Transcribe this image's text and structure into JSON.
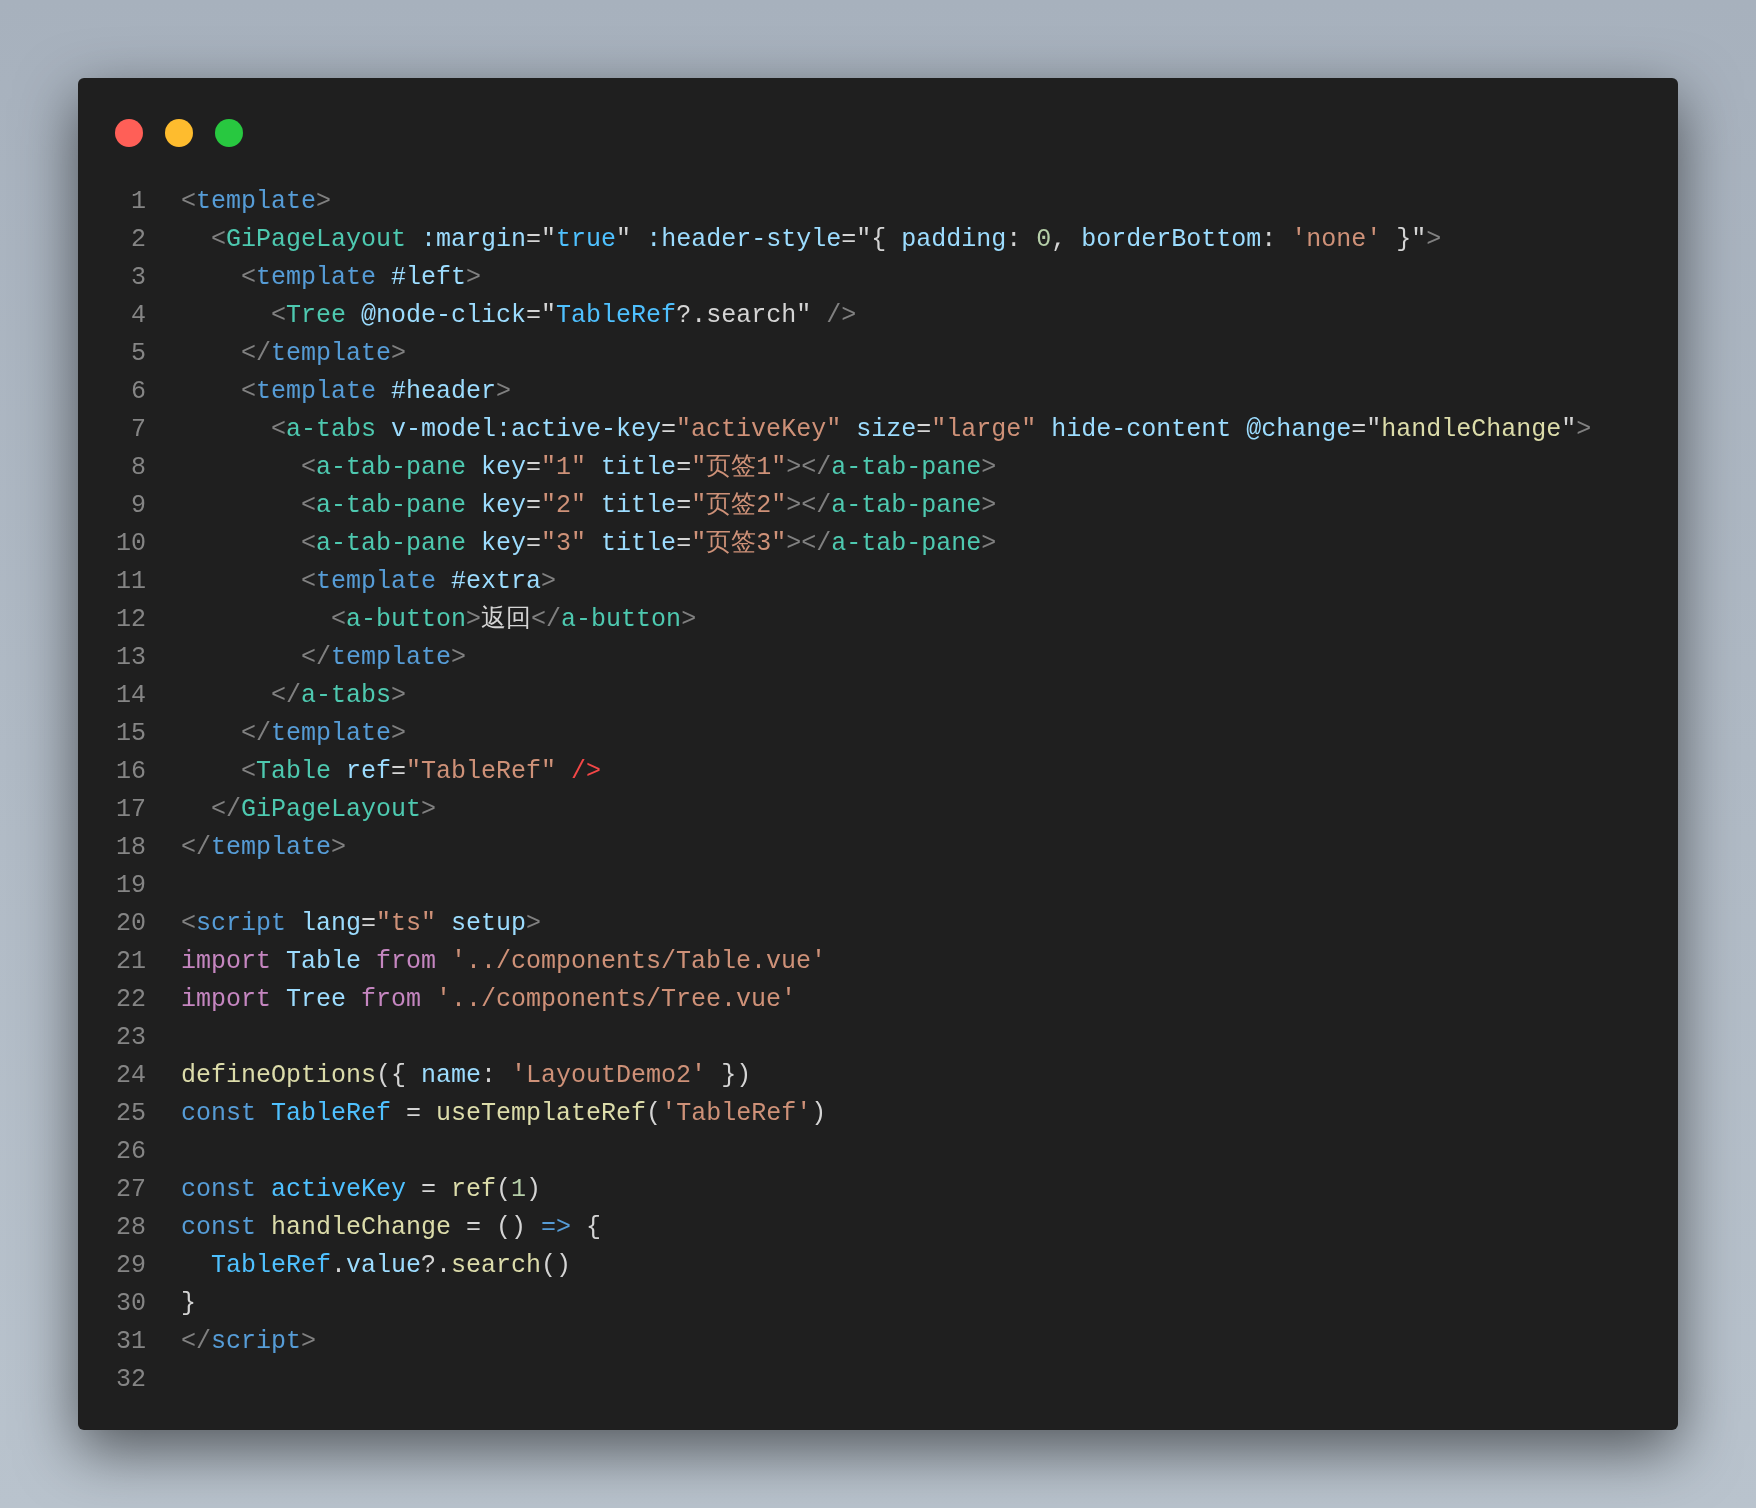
{
  "window_controls": [
    {
      "color": "#ff5f57"
    },
    {
      "color": "#febc2e"
    },
    {
      "color": "#28c840"
    }
  ],
  "code_lines": [
    {
      "number": "1",
      "tokens": [
        {
          "text": "<",
          "kind": "punct"
        },
        {
          "text": "template",
          "kind": "tag"
        },
        {
          "text": ">",
          "kind": "punct"
        }
      ]
    },
    {
      "number": "2",
      "tokens": [
        {
          "text": "  <",
          "kind": "punct"
        },
        {
          "text": "GiPageLayout",
          "kind": "component"
        },
        {
          "text": " :margin",
          "kind": "attr"
        },
        {
          "text": "=\"",
          "kind": "plain"
        },
        {
          "text": "true",
          "kind": "const"
        },
        {
          "text": "\"",
          "kind": "plain"
        },
        {
          "text": " :header-style",
          "kind": "attr"
        },
        {
          "text": "=\"{ ",
          "kind": "plain"
        },
        {
          "text": "padding",
          "kind": "attr"
        },
        {
          "text": ": ",
          "kind": "plain"
        },
        {
          "text": "0",
          "kind": "num"
        },
        {
          "text": ", ",
          "kind": "plain"
        },
        {
          "text": "borderBottom",
          "kind": "attr"
        },
        {
          "text": ": ",
          "kind": "plain"
        },
        {
          "text": "'none'",
          "kind": "string"
        },
        {
          "text": " }\"",
          "kind": "plain"
        },
        {
          "text": ">",
          "kind": "punct"
        }
      ]
    },
    {
      "number": "3",
      "tokens": [
        {
          "text": "    <",
          "kind": "punct"
        },
        {
          "text": "template",
          "kind": "tag"
        },
        {
          "text": " #left",
          "kind": "attr"
        },
        {
          "text": ">",
          "kind": "punct"
        }
      ]
    },
    {
      "number": "4",
      "tokens": [
        {
          "text": "      <",
          "kind": "punct"
        },
        {
          "text": "Tree",
          "kind": "component"
        },
        {
          "text": " @node-click",
          "kind": "attr"
        },
        {
          "text": "=\"",
          "kind": "plain"
        },
        {
          "text": "TableRef",
          "kind": "const"
        },
        {
          "text": "?.search\"",
          "kind": "plain"
        },
        {
          "text": " />",
          "kind": "punct"
        }
      ]
    },
    {
      "number": "5",
      "tokens": [
        {
          "text": "    </",
          "kind": "punct"
        },
        {
          "text": "template",
          "kind": "tag"
        },
        {
          "text": ">",
          "kind": "punct"
        }
      ]
    },
    {
      "number": "6",
      "tokens": [
        {
          "text": "    <",
          "kind": "punct"
        },
        {
          "text": "template",
          "kind": "tag"
        },
        {
          "text": " #header",
          "kind": "attr"
        },
        {
          "text": ">",
          "kind": "punct"
        }
      ]
    },
    {
      "number": "7",
      "tokens": [
        {
          "text": "      <",
          "kind": "punct"
        },
        {
          "text": "a-tabs",
          "kind": "component"
        },
        {
          "text": " v-model:active-key",
          "kind": "attr"
        },
        {
          "text": "=",
          "kind": "plain"
        },
        {
          "text": "\"activeKey\"",
          "kind": "string"
        },
        {
          "text": " size",
          "kind": "attr"
        },
        {
          "text": "=",
          "kind": "plain"
        },
        {
          "text": "\"large\"",
          "kind": "string"
        },
        {
          "text": " hide-content @change",
          "kind": "attr"
        },
        {
          "text": "=\"",
          "kind": "plain"
        },
        {
          "text": "handleChange",
          "kind": "fn"
        },
        {
          "text": "\"",
          "kind": "plain"
        },
        {
          "text": ">",
          "kind": "punct"
        }
      ]
    },
    {
      "number": "8",
      "tokens": [
        {
          "text": "        <",
          "kind": "punct"
        },
        {
          "text": "a-tab-pane",
          "kind": "component"
        },
        {
          "text": " key",
          "kind": "attr"
        },
        {
          "text": "=",
          "kind": "plain"
        },
        {
          "text": "\"1\"",
          "kind": "string"
        },
        {
          "text": " title",
          "kind": "attr"
        },
        {
          "text": "=",
          "kind": "plain"
        },
        {
          "text": "\"页签1\"",
          "kind": "string"
        },
        {
          "text": "></",
          "kind": "punct"
        },
        {
          "text": "a-tab-pane",
          "kind": "component"
        },
        {
          "text": ">",
          "kind": "punct"
        }
      ]
    },
    {
      "number": "9",
      "tokens": [
        {
          "text": "        <",
          "kind": "punct"
        },
        {
          "text": "a-tab-pane",
          "kind": "component"
        },
        {
          "text": " key",
          "kind": "attr"
        },
        {
          "text": "=",
          "kind": "plain"
        },
        {
          "text": "\"2\"",
          "kind": "string"
        },
        {
          "text": " title",
          "kind": "attr"
        },
        {
          "text": "=",
          "kind": "plain"
        },
        {
          "text": "\"页签2\"",
          "kind": "string"
        },
        {
          "text": "></",
          "kind": "punct"
        },
        {
          "text": "a-tab-pane",
          "kind": "component"
        },
        {
          "text": ">",
          "kind": "punct"
        }
      ]
    },
    {
      "number": "10",
      "tokens": [
        {
          "text": "        <",
          "kind": "punct"
        },
        {
          "text": "a-tab-pane",
          "kind": "component"
        },
        {
          "text": " key",
          "kind": "attr"
        },
        {
          "text": "=",
          "kind": "plain"
        },
        {
          "text": "\"3\"",
          "kind": "string"
        },
        {
          "text": " title",
          "kind": "attr"
        },
        {
          "text": "=",
          "kind": "plain"
        },
        {
          "text": "\"页签3\"",
          "kind": "string"
        },
        {
          "text": "></",
          "kind": "punct"
        },
        {
          "text": "a-tab-pane",
          "kind": "component"
        },
        {
          "text": ">",
          "kind": "punct"
        }
      ]
    },
    {
      "number": "11",
      "tokens": [
        {
          "text": "        <",
          "kind": "punct"
        },
        {
          "text": "template",
          "kind": "tag"
        },
        {
          "text": " #extra",
          "kind": "attr"
        },
        {
          "text": ">",
          "kind": "punct"
        }
      ]
    },
    {
      "number": "12",
      "tokens": [
        {
          "text": "          <",
          "kind": "punct"
        },
        {
          "text": "a-button",
          "kind": "component"
        },
        {
          "text": ">",
          "kind": "punct"
        },
        {
          "text": "返回",
          "kind": "plain"
        },
        {
          "text": "</",
          "kind": "punct"
        },
        {
          "text": "a-button",
          "kind": "component"
        },
        {
          "text": ">",
          "kind": "punct"
        }
      ]
    },
    {
      "number": "13",
      "tokens": [
        {
          "text": "        </",
          "kind": "punct"
        },
        {
          "text": "template",
          "kind": "tag"
        },
        {
          "text": ">",
          "kind": "punct"
        }
      ]
    },
    {
      "number": "14",
      "tokens": [
        {
          "text": "      </",
          "kind": "punct"
        },
        {
          "text": "a-tabs",
          "kind": "component"
        },
        {
          "text": ">",
          "kind": "punct"
        }
      ]
    },
    {
      "number": "15",
      "tokens": [
        {
          "text": "    </",
          "kind": "punct"
        },
        {
          "text": "template",
          "kind": "tag"
        },
        {
          "text": ">",
          "kind": "punct"
        }
      ]
    },
    {
      "number": "16",
      "tokens": [
        {
          "text": "    <",
          "kind": "punct"
        },
        {
          "text": "Table",
          "kind": "component"
        },
        {
          "text": " ref",
          "kind": "attr"
        },
        {
          "text": "=",
          "kind": "plain"
        },
        {
          "text": "\"TableRef\"",
          "kind": "string"
        },
        {
          "text": " />",
          "kind": "error"
        }
      ]
    },
    {
      "number": "17",
      "tokens": [
        {
          "text": "  </",
          "kind": "punct"
        },
        {
          "text": "GiPageLayout",
          "kind": "component"
        },
        {
          "text": ">",
          "kind": "punct"
        }
      ]
    },
    {
      "number": "18",
      "tokens": [
        {
          "text": "</",
          "kind": "punct"
        },
        {
          "text": "template",
          "kind": "tag"
        },
        {
          "text": ">",
          "kind": "punct"
        }
      ]
    },
    {
      "number": "19"
    },
    {
      "number": "20",
      "tokens": [
        {
          "text": "<",
          "kind": "punct"
        },
        {
          "text": "script",
          "kind": "tag"
        },
        {
          "text": " lang",
          "kind": "attr"
        },
        {
          "text": "=",
          "kind": "plain"
        },
        {
          "text": "\"ts\"",
          "kind": "string"
        },
        {
          "text": " setup",
          "kind": "attr"
        },
        {
          "text": ">",
          "kind": "punct"
        }
      ]
    },
    {
      "number": "21",
      "tokens": [
        {
          "text": "import",
          "kind": "keyword"
        },
        {
          "text": " Table ",
          "kind": "var"
        },
        {
          "text": "from",
          "kind": "keyword"
        },
        {
          "text": " '../components/Table.vue'",
          "kind": "string"
        }
      ]
    },
    {
      "number": "22",
      "tokens": [
        {
          "text": "import",
          "kind": "keyword"
        },
        {
          "text": " Tree ",
          "kind": "var"
        },
        {
          "text": "from",
          "kind": "keyword"
        },
        {
          "text": " '../components/Tree.vue'",
          "kind": "string"
        }
      ]
    },
    {
      "number": "23"
    },
    {
      "number": "24",
      "tokens": [
        {
          "text": "defineOptions",
          "kind": "fn"
        },
        {
          "text": "({ ",
          "kind": "plain"
        },
        {
          "text": "name",
          "kind": "var"
        },
        {
          "text": ": ",
          "kind": "plain"
        },
        {
          "text": "'LayoutDemo2'",
          "kind": "string"
        },
        {
          "text": " })",
          "kind": "plain"
        }
      ]
    },
    {
      "number": "25",
      "tokens": [
        {
          "text": "const",
          "kind": "storage"
        },
        {
          "text": " TableRef",
          "kind": "const"
        },
        {
          "text": " = ",
          "kind": "plain"
        },
        {
          "text": "useTemplateRef",
          "kind": "fn"
        },
        {
          "text": "(",
          "kind": "plain"
        },
        {
          "text": "'TableRef'",
          "kind": "string"
        },
        {
          "text": ")",
          "kind": "plain"
        }
      ]
    },
    {
      "number": "26"
    },
    {
      "number": "27",
      "tokens": [
        {
          "text": "const",
          "kind": "storage"
        },
        {
          "text": " activeKey",
          "kind": "const"
        },
        {
          "text": " = ",
          "kind": "plain"
        },
        {
          "text": "ref",
          "kind": "fn"
        },
        {
          "text": "(",
          "kind": "plain"
        },
        {
          "text": "1",
          "kind": "num"
        },
        {
          "text": ")",
          "kind": "plain"
        }
      ]
    },
    {
      "number": "28",
      "tokens": [
        {
          "text": "const",
          "kind": "storage"
        },
        {
          "text": " handleChange",
          "kind": "fn"
        },
        {
          "text": " = () ",
          "kind": "plain"
        },
        {
          "text": "=>",
          "kind": "storage"
        },
        {
          "text": " {",
          "kind": "plain"
        }
      ]
    },
    {
      "number": "29",
      "tokens": [
        {
          "text": "  TableRef",
          "kind": "const"
        },
        {
          "text": ".",
          "kind": "plain"
        },
        {
          "text": "value",
          "kind": "var"
        },
        {
          "text": "?.",
          "kind": "plain"
        },
        {
          "text": "search",
          "kind": "fn"
        },
        {
          "text": "()",
          "kind": "plain"
        }
      ]
    },
    {
      "number": "30",
      "tokens": [
        {
          "text": "}",
          "kind": "plain"
        }
      ]
    },
    {
      "number": "31",
      "tokens": [
        {
          "text": "</",
          "kind": "punct"
        },
        {
          "text": "script",
          "kind": "tag"
        },
        {
          "text": ">",
          "kind": "punct"
        }
      ]
    },
    {
      "number": "32"
    }
  ]
}
